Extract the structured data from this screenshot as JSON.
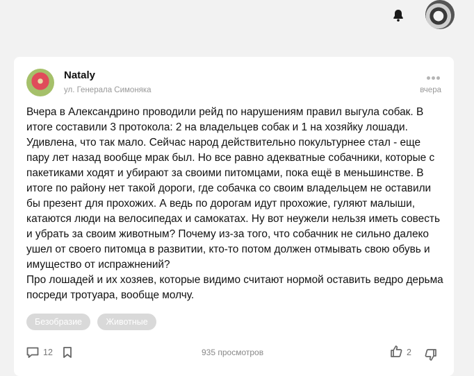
{
  "header": {
    "notification_icon": "bell-icon",
    "user_avatar": "user-avatar"
  },
  "post": {
    "author": "Nataly",
    "location": "ул. Генерала Симоняка",
    "date": "вчера",
    "paragraphs": [
      "Вчера в Александрино проводили рейд по нарушениям правил выгула собак. В итоге составили 3 протокола: 2 на владельцев собак и 1 на хозяйку лошади. Удивлена, что так мало. Сейчас народ действительно покультурнее стал - еще пару лет назад вообще мрак был. Но все равно адекватные собачники, которые с пакетиками ходят и убирают за своими питомцами, пока ещё в меньшинстве. В итоге по району нет такой дороги, где собачка со своим владельцем не оставили бы презент для прохожих. А ведь по дорогам идут прохожие, гуляют малыши, катаются люди на велосипедах и самокатах. Ну вот неужели нельзя иметь совесть и убрать за своим животным? Почему из-за того, что собачник не сильно далеко ушел от своего питомца в развитии, кто-то потом должен отмывать свою обувь и имущество от испражнений?",
      "Про лошадей и их хозяев, которые видимо считают нормой оставить ведро дерьма посреди тротуара, вообще молчу."
    ],
    "tags": [
      "Безобразие",
      "Животные"
    ],
    "comments_count": "12",
    "views": "935 просмотров",
    "likes_count": "2"
  },
  "colors": {
    "background": "#f2f2f2",
    "card": "#ffffff",
    "tag_bg": "#d9d9d9",
    "muted_text": "#999999"
  }
}
